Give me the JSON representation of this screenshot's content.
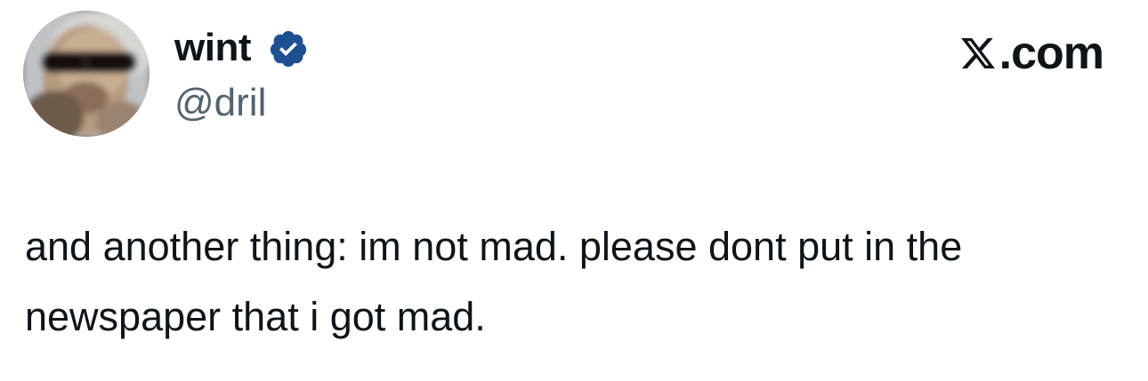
{
  "author": {
    "display_name": "wint",
    "handle": "@dril",
    "verified": true,
    "verified_color": "#1d4f91"
  },
  "brand": {
    "suffix": ".com",
    "logo_icon": "x-logo-icon"
  },
  "tweet": {
    "text": "and another thing: im not mad. please dont put in the newspaper that i got mad."
  },
  "colors": {
    "text": "#0f1419",
    "secondary_text": "#536471",
    "background": "#ffffff"
  }
}
